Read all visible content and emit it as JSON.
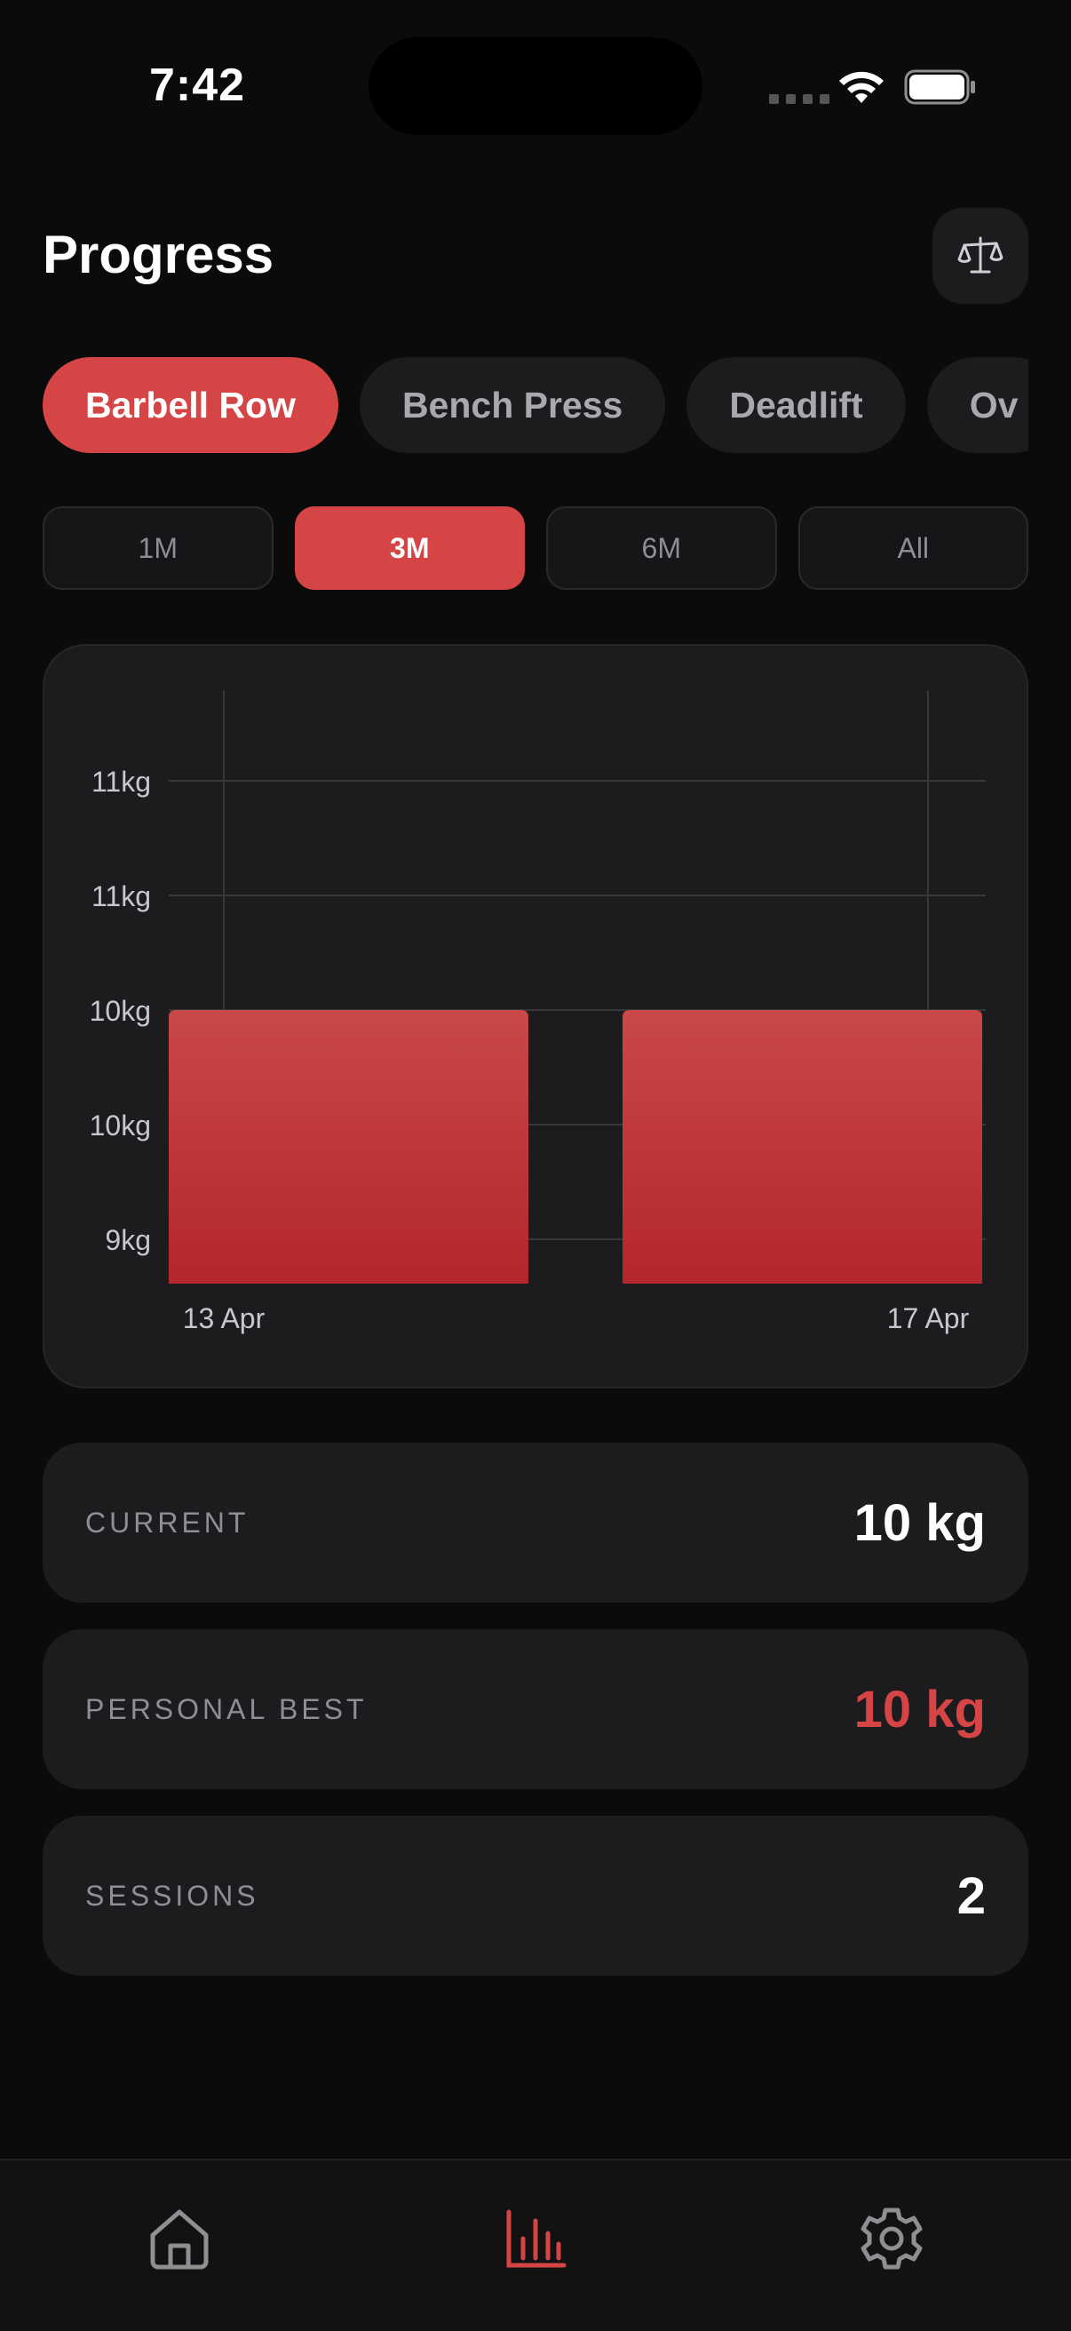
{
  "status_bar": {
    "time": "7:42"
  },
  "header": {
    "title": "Progress",
    "action_icon": "scale-icon"
  },
  "exercises": [
    {
      "label": "Barbell Row",
      "active": true
    },
    {
      "label": "Bench Press",
      "active": false
    },
    {
      "label": "Deadlift",
      "active": false
    },
    {
      "label": "Ov",
      "active": false
    }
  ],
  "ranges": [
    {
      "label": "1M",
      "active": false
    },
    {
      "label": "3M",
      "active": true
    },
    {
      "label": "6M",
      "active": false
    },
    {
      "label": "All",
      "active": false
    }
  ],
  "chart_data": {
    "type": "bar",
    "categories": [
      "13 Apr",
      "17 Apr"
    ],
    "values": [
      10,
      10
    ],
    "y_ticks": [
      "11kg",
      "11kg",
      "10kg",
      "10kg",
      "9kg"
    ],
    "ylim": [
      9,
      11
    ],
    "grid": true,
    "bar_color": "#d64545"
  },
  "stats": [
    {
      "label": "CURRENT",
      "value": "10 kg",
      "accent": false
    },
    {
      "label": "PERSONAL BEST",
      "value": "10 kg",
      "accent": true
    },
    {
      "label": "SESSIONS",
      "value": "2",
      "accent": false
    }
  ],
  "tabbar": [
    {
      "icon": "home-icon",
      "active": false
    },
    {
      "icon": "chart-icon",
      "active": true
    },
    {
      "icon": "gear-icon",
      "active": false
    }
  ],
  "colors": {
    "accent": "#d64545",
    "background": "#0b0b0b",
    "card": "#1c1c1e"
  }
}
